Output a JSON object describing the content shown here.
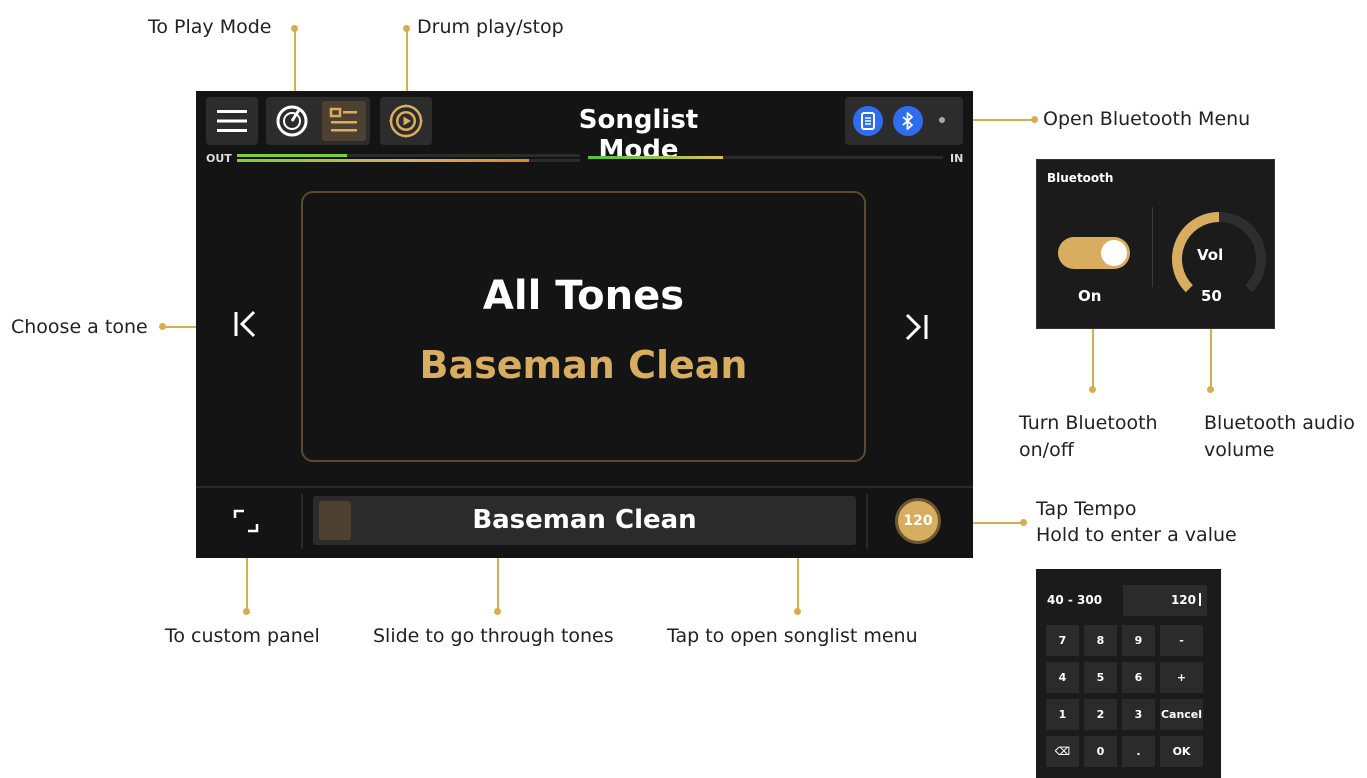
{
  "annotations": {
    "to_play_mode": "To Play Mode",
    "drum_play_stop": "Drum play/stop",
    "open_bluetooth_menu": "Open Bluetooth Menu",
    "choose_a_tone": "Choose a tone",
    "turn_bluetooth_line1": "Turn Bluetooth",
    "turn_bluetooth_line2": "on/off",
    "bt_audio_line1": "Bluetooth audio",
    "bt_audio_line2": "volume",
    "tap_tempo_line1": "Tap Tempo",
    "tap_tempo_line2": "Hold to enter a value",
    "to_custom_panel": "To custom panel",
    "slide_tones": "Slide to go through tones",
    "tap_songlist": "Tap to open songlist menu"
  },
  "screen": {
    "title": "Songlist Mode",
    "meter_out_label": "OUT",
    "meter_in_label": "IN",
    "tone_group": "All Tones",
    "tone_name": "Baseman Clean",
    "slider_label": "Baseman Clean",
    "tempo": "120"
  },
  "meters": {
    "out_green": 0.32,
    "out_orange": 0.85,
    "in_level": 0.38
  },
  "bluetooth_panel": {
    "title": "Bluetooth",
    "state": "On",
    "vol_label": "Vol",
    "vol_value": "50",
    "vol_fraction": 0.5
  },
  "keypad": {
    "range": "40 - 300",
    "display": "120",
    "rows": [
      [
        "7",
        "8",
        "9",
        "-"
      ],
      [
        "4",
        "5",
        "6",
        "+"
      ],
      [
        "1",
        "2",
        "3",
        "Cancel"
      ],
      [
        "⌫",
        "0",
        ".",
        "OK"
      ]
    ]
  },
  "colors": {
    "accent": "#d9ad4f",
    "screen_bg": "#141414",
    "bt_blue": "#2f6df0"
  }
}
